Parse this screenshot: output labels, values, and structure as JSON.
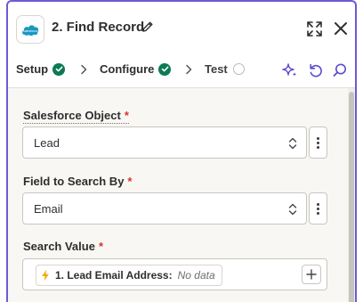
{
  "header": {
    "app_icon": "salesforce-cloud-icon",
    "title": "2. Find Record",
    "edit_icon": "pencil-icon",
    "expand_icon": "expand-icon",
    "close_icon": "close-icon"
  },
  "tabs": [
    {
      "label": "Setup",
      "status": "complete"
    },
    {
      "label": "Configure",
      "status": "complete"
    },
    {
      "label": "Test",
      "status": "pending"
    }
  ],
  "toolbar_icons": [
    "sparkle-icon",
    "undo-icon",
    "search-icon"
  ],
  "form": {
    "object": {
      "label": "Salesforce Object",
      "required_mark": "*",
      "value": "Lead"
    },
    "search_field": {
      "label": "Field to Search By",
      "required_mark": "*",
      "value": "Email"
    },
    "search_value": {
      "label": "Search Value",
      "required_mark": "*",
      "pill_name": "1. Lead Email Address:",
      "pill_value": "No data"
    }
  },
  "colors": {
    "accent_border": "#6b5bd6",
    "success": "#0b7a57",
    "required": "#d8342c",
    "salesforce_blue": "#1798c1",
    "bolt": "#f2a900"
  }
}
